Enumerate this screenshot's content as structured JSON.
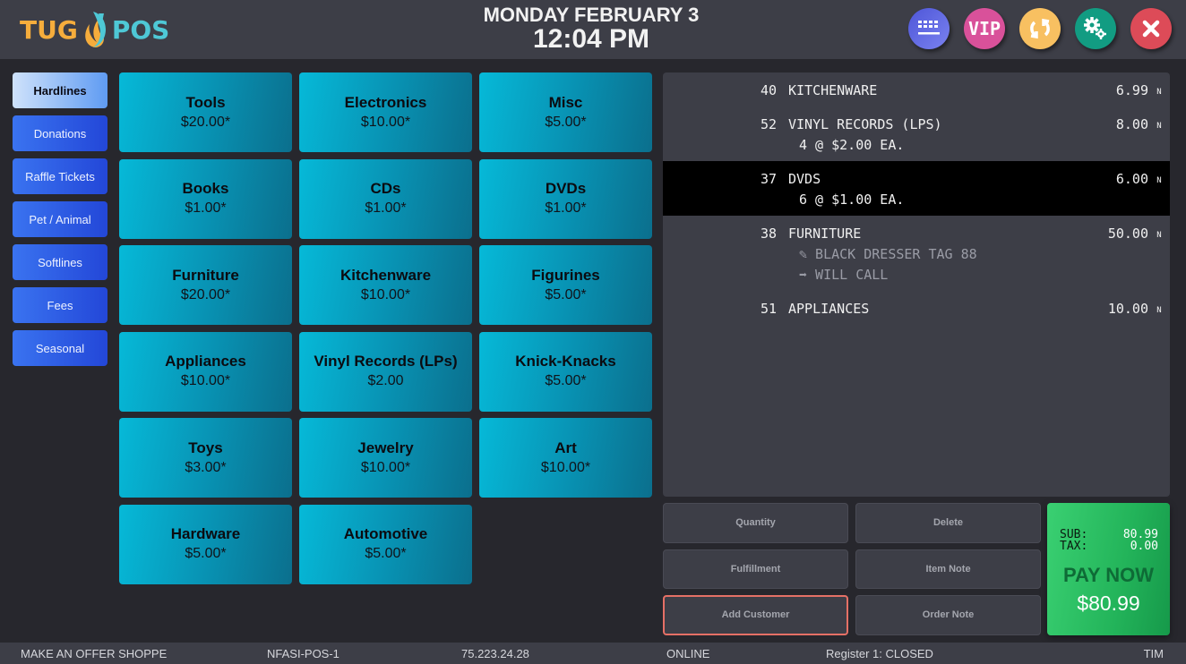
{
  "header": {
    "logo_left": "TUG",
    "logo_right": "POS",
    "date": "MONDAY FEBRUARY 3",
    "time": "12:04 PM",
    "buttons": [
      {
        "name": "keyboard-button",
        "icon": "keyboard-icon",
        "label": ""
      },
      {
        "name": "vip-button",
        "icon": "vip-icon",
        "label": "VIP"
      },
      {
        "name": "sync-button",
        "icon": "sync-icon",
        "label": ""
      },
      {
        "name": "settings-button",
        "icon": "gear-icon",
        "label": ""
      },
      {
        "name": "close-button",
        "icon": "close-icon",
        "label": ""
      }
    ]
  },
  "categories": [
    {
      "label": "Hardlines",
      "active": true
    },
    {
      "label": "Donations",
      "active": false
    },
    {
      "label": "Raffle Tickets",
      "active": false
    },
    {
      "label": "Pet / Animal",
      "active": false
    },
    {
      "label": "Softlines",
      "active": false
    },
    {
      "label": "Fees",
      "active": false
    },
    {
      "label": "Seasonal",
      "active": false
    }
  ],
  "products": [
    {
      "name": "Tools",
      "price": "$20.00*"
    },
    {
      "name": "Electronics",
      "price": "$10.00*"
    },
    {
      "name": "Misc",
      "price": "$5.00*"
    },
    {
      "name": "Books",
      "price": "$1.00*"
    },
    {
      "name": "CDs",
      "price": "$1.00*"
    },
    {
      "name": "DVDs",
      "price": "$1.00*"
    },
    {
      "name": "Furniture",
      "price": "$20.00*"
    },
    {
      "name": "Kitchenware",
      "price": "$10.00*"
    },
    {
      "name": "Figurines",
      "price": "$5.00*"
    },
    {
      "name": "Appliances",
      "price": "$10.00*"
    },
    {
      "name": "Vinyl Records (LPs)",
      "price": "$2.00"
    },
    {
      "name": "Knick-Knacks",
      "price": "$5.00*"
    },
    {
      "name": "Toys",
      "price": "$3.00*"
    },
    {
      "name": "Jewelry",
      "price": "$10.00*"
    },
    {
      "name": "Art",
      "price": "$10.00*"
    },
    {
      "name": "Hardware",
      "price": "$5.00*"
    },
    {
      "name": "Automotive",
      "price": "$5.00*"
    }
  ],
  "ticket": {
    "lines": [
      {
        "code": "40",
        "desc": "KITCHENWARE",
        "amount": "6.99",
        "tax": "N",
        "selected": false,
        "subs": []
      },
      {
        "code": "52",
        "desc": "VINYL RECORDS (LPS)",
        "amount": "8.00",
        "tax": "N",
        "selected": false,
        "subs": [
          {
            "text": "4 @ $2.00 EA.",
            "note": false
          }
        ]
      },
      {
        "code": "37",
        "desc": "DVDS",
        "amount": "6.00",
        "tax": "N",
        "selected": true,
        "subs": [
          {
            "text": "6 @ $1.00 EA.",
            "note": false
          }
        ]
      },
      {
        "code": "38",
        "desc": "FURNITURE",
        "amount": "50.00",
        "tax": "N",
        "selected": false,
        "subs": [
          {
            "text": "✎ BLACK DRESSER TAG 88",
            "note": true
          },
          {
            "text": "➡ WILL CALL",
            "note": true
          }
        ]
      },
      {
        "code": "51",
        "desc": "APPLIANCES",
        "amount": "10.00",
        "tax": "N",
        "selected": false,
        "subs": []
      }
    ]
  },
  "actions": [
    {
      "label": "Quantity",
      "highlight": false
    },
    {
      "label": "Delete",
      "highlight": false
    },
    {
      "label": "Fulfillment",
      "highlight": false
    },
    {
      "label": "Item Note",
      "highlight": false
    },
    {
      "label": "Add Customer",
      "highlight": true
    },
    {
      "label": "Order Note",
      "highlight": false
    }
  ],
  "pay": {
    "sub_label": "SUB:",
    "sub_value": "80.99",
    "tax_label": "TAX:",
    "tax_value": "0.00",
    "pay_label": "PAY NOW",
    "total": "$80.99"
  },
  "status": {
    "store": "MAKE AN OFFER SHOPPE",
    "terminal": "NFASI-POS-1",
    "ip": "75.223.24.28",
    "connection": "ONLINE",
    "register": "Register 1: CLOSED",
    "user": "TIM"
  },
  "colors": {
    "accent_category": "#2f5ee6",
    "product_tile": "#0894b5",
    "pay_green": "#23b45a",
    "highlight_border": "#e57066"
  }
}
